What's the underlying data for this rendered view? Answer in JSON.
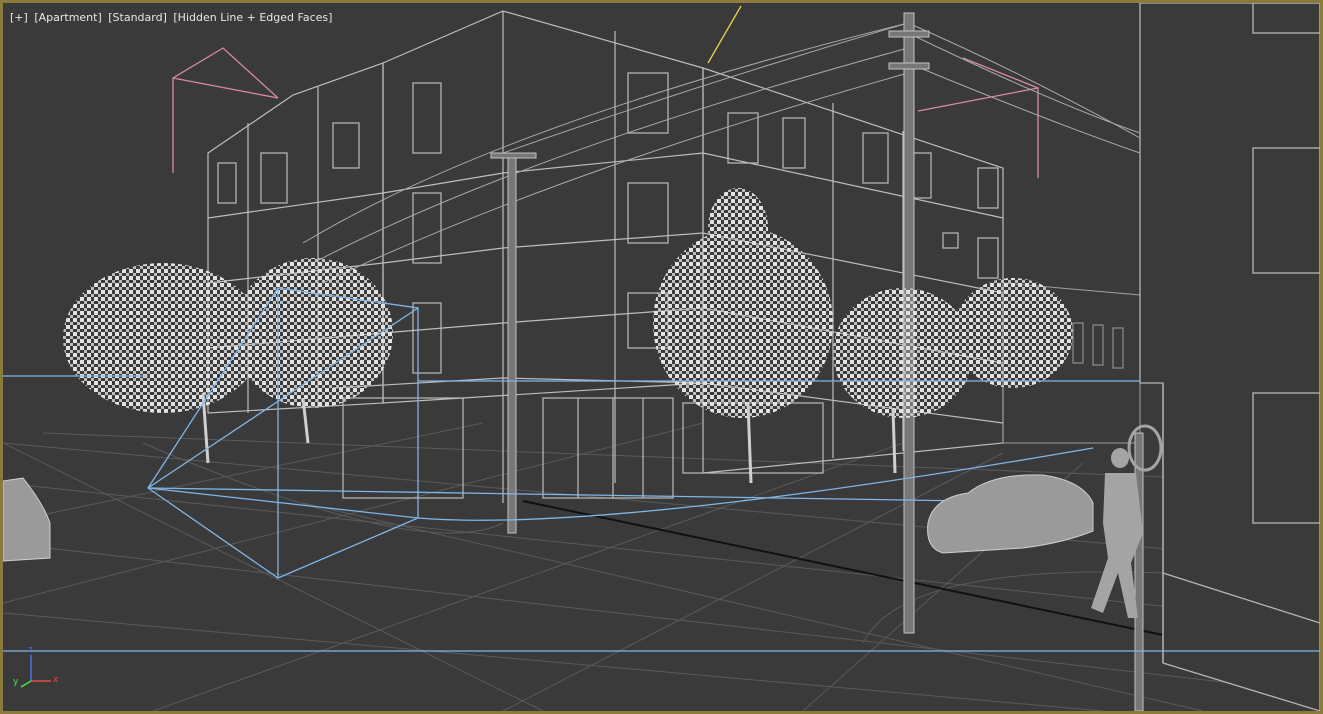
{
  "viewport": {
    "label_plus": "[+]",
    "label_camera": "[Apartment]",
    "label_shading": "[Standard]",
    "label_style": "[Hidden Line + Edged Faces]",
    "border_color": "#8a7a3c",
    "background_color": "#3a3a3a"
  },
  "axis_gizmo": {
    "x_label": "x",
    "y_label": "y",
    "z_label": "z"
  },
  "colors": {
    "wire": "#bdbdbd",
    "ground_wire": "#5e5e5e",
    "camera_blue": "#7fb6e6",
    "light_pink": "#d88aa6",
    "selection_yellow": "#e8d24a",
    "foliage": "#dcdcdc",
    "solid_object": "#9a9a9a"
  }
}
